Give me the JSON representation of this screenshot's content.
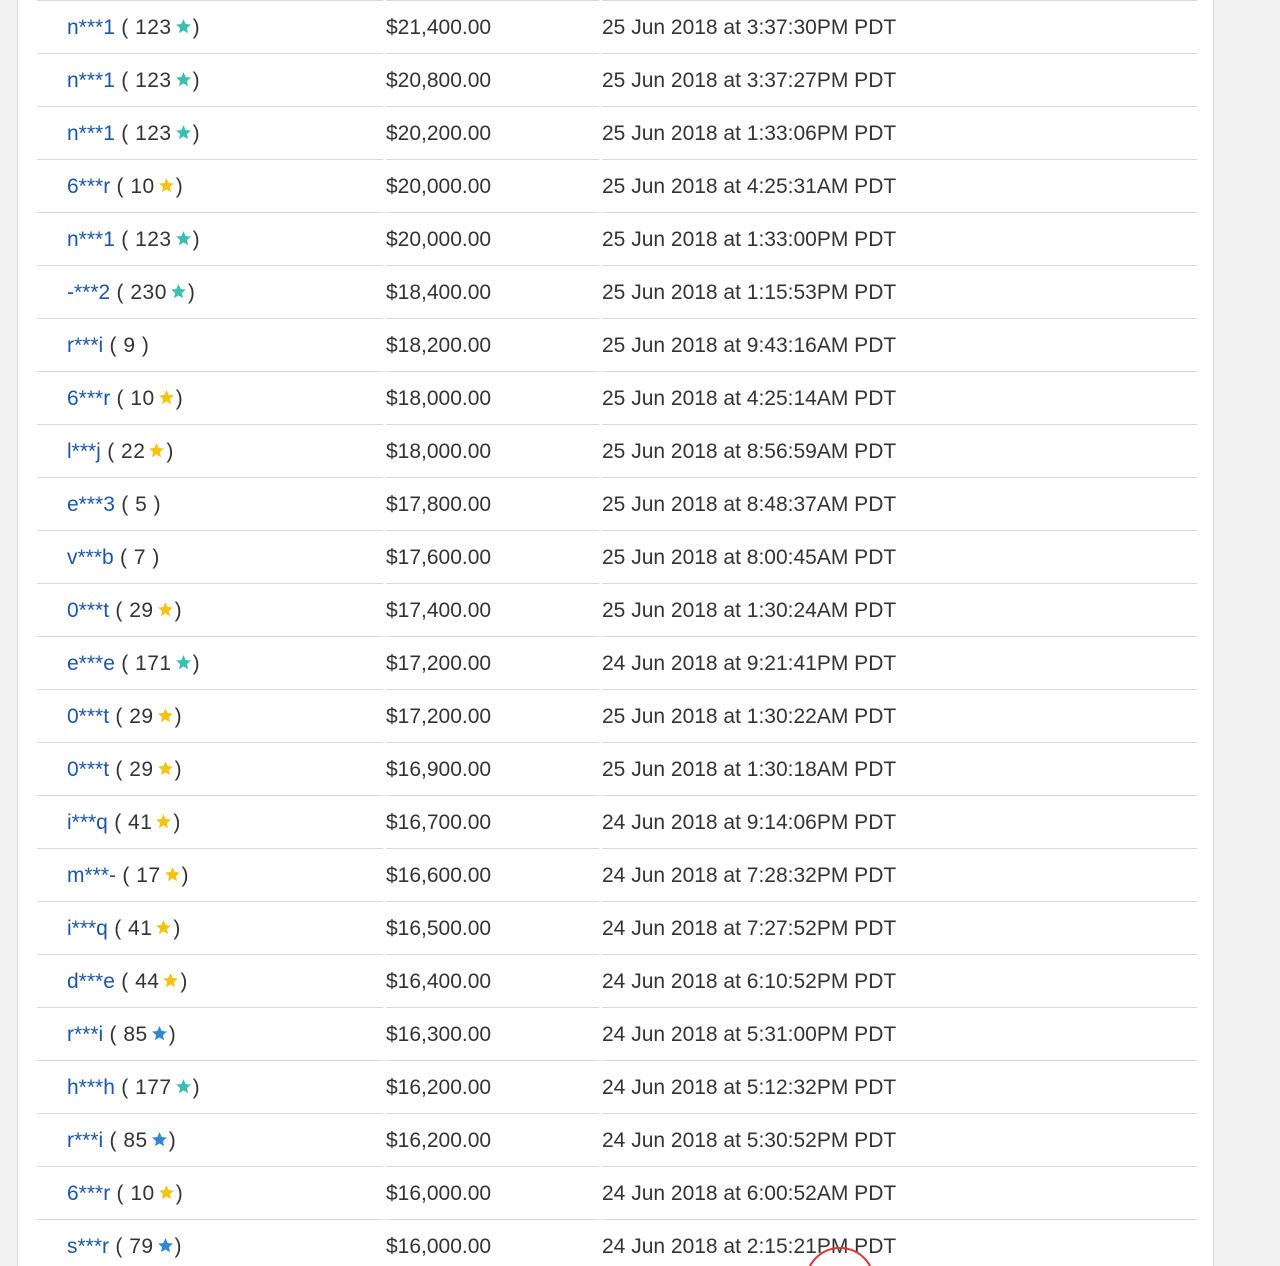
{
  "colors": {
    "link": "#1b56a8",
    "text": "#333333",
    "star_yellow": "#f3c316",
    "star_turquoise": "#3cbfae",
    "star_blue": "#2f86d4",
    "divider": "#d9d9d9"
  },
  "bids": [
    {
      "user": "n***1",
      "score": "123",
      "star": "turquoise",
      "amount": "$21,400.00",
      "time": "25 Jun 2018 at 3:37:30PM PDT"
    },
    {
      "user": "n***1",
      "score": "123",
      "star": "turquoise",
      "amount": "$20,800.00",
      "time": "25 Jun 2018 at 3:37:27PM PDT"
    },
    {
      "user": "n***1",
      "score": "123",
      "star": "turquoise",
      "amount": "$20,200.00",
      "time": "25 Jun 2018 at 1:33:06PM PDT"
    },
    {
      "user": "6***r",
      "score": "10",
      "star": "yellow",
      "amount": "$20,000.00",
      "time": "25 Jun 2018 at 4:25:31AM PDT"
    },
    {
      "user": "n***1",
      "score": "123",
      "star": "turquoise",
      "amount": "$20,000.00",
      "time": "25 Jun 2018 at 1:33:00PM PDT"
    },
    {
      "user": "-***2",
      "score": "230",
      "star": "turquoise",
      "amount": "$18,400.00",
      "time": "25 Jun 2018 at 1:15:53PM PDT"
    },
    {
      "user": "r***i",
      "score": "9",
      "star": "none",
      "amount": "$18,200.00",
      "time": "25 Jun 2018 at 9:43:16AM PDT"
    },
    {
      "user": "6***r",
      "score": "10",
      "star": "yellow",
      "amount": "$18,000.00",
      "time": "25 Jun 2018 at 4:25:14AM PDT"
    },
    {
      "user": "l***j",
      "score": "22",
      "star": "yellow",
      "amount": "$18,000.00",
      "time": "25 Jun 2018 at 8:56:59AM PDT"
    },
    {
      "user": "e***3",
      "score": "5",
      "star": "none",
      "amount": "$17,800.00",
      "time": "25 Jun 2018 at 8:48:37AM PDT"
    },
    {
      "user": "v***b",
      "score": "7",
      "star": "none",
      "amount": "$17,600.00",
      "time": "25 Jun 2018 at 8:00:45AM PDT"
    },
    {
      "user": "0***t",
      "score": "29",
      "star": "yellow",
      "amount": "$17,400.00",
      "time": "25 Jun 2018 at 1:30:24AM PDT"
    },
    {
      "user": "e***e",
      "score": "171",
      "star": "turquoise",
      "amount": "$17,200.00",
      "time": "24 Jun 2018 at 9:21:41PM PDT"
    },
    {
      "user": "0***t",
      "score": "29",
      "star": "yellow",
      "amount": "$17,200.00",
      "time": "25 Jun 2018 at 1:30:22AM PDT"
    },
    {
      "user": "0***t",
      "score": "29",
      "star": "yellow",
      "amount": "$16,900.00",
      "time": "25 Jun 2018 at 1:30:18AM PDT"
    },
    {
      "user": "i***q",
      "score": "41",
      "star": "yellow",
      "amount": "$16,700.00",
      "time": "24 Jun 2018 at 9:14:06PM PDT"
    },
    {
      "user": "m***-",
      "score": "17",
      "star": "yellow",
      "amount": "$16,600.00",
      "time": "24 Jun 2018 at 7:28:32PM PDT"
    },
    {
      "user": "i***q",
      "score": "41",
      "star": "yellow",
      "amount": "$16,500.00",
      "time": "24 Jun 2018 at 7:27:52PM PDT"
    },
    {
      "user": "d***e",
      "score": "44",
      "star": "yellow",
      "amount": "$16,400.00",
      "time": "24 Jun 2018 at 6:10:52PM PDT"
    },
    {
      "user": "r***i",
      "score": "85",
      "star": "blue",
      "amount": "$16,300.00",
      "time": "24 Jun 2018 at 5:31:00PM PDT"
    },
    {
      "user": "h***h",
      "score": "177",
      "star": "turquoise",
      "amount": "$16,200.00",
      "time": "24 Jun 2018 at 5:12:32PM PDT"
    },
    {
      "user": "r***i",
      "score": "85",
      "star": "blue",
      "amount": "$16,200.00",
      "time": "24 Jun 2018 at 5:30:52PM PDT"
    },
    {
      "user": "6***r",
      "score": "10",
      "star": "yellow",
      "amount": "$16,000.00",
      "time": "24 Jun 2018 at 6:00:52AM PDT"
    },
    {
      "user": "s***r",
      "score": "79",
      "star": "blue",
      "amount": "$16,000.00",
      "time": "24 Jun 2018 at 2:15:21PM PDT"
    }
  ]
}
